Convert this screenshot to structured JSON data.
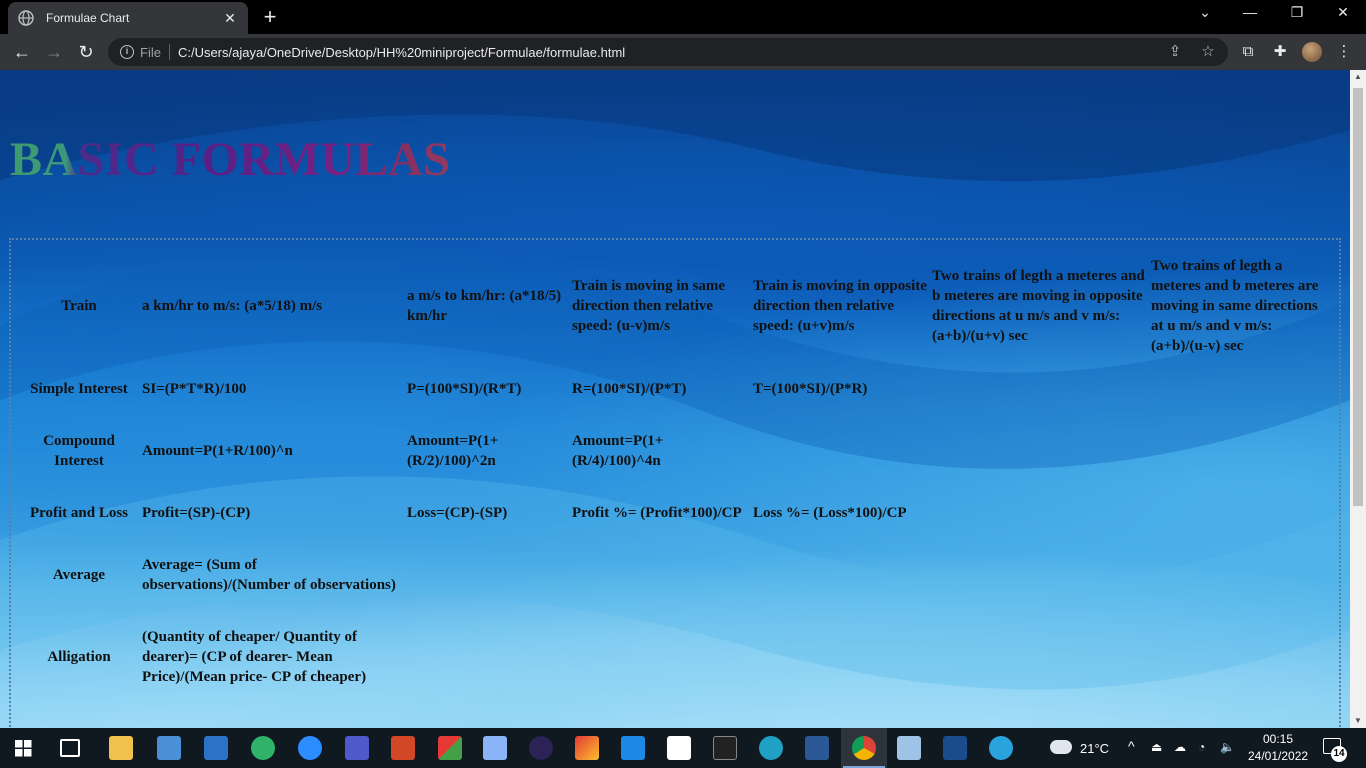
{
  "browser": {
    "tab_title": "Formulae Chart",
    "file_label": "File",
    "url": "C:/Users/ajaya/OneDrive/Desktop/HH%20miniproject/Formulae/formulae.html"
  },
  "page": {
    "title": "BASIC FORMULAS",
    "rows": [
      {
        "head": "Train",
        "cells": [
          "a km/hr to m/s: (a*5/18) m/s",
          "a m/s to km/hr: (a*18/5) km/hr",
          "Train is moving in same direction then relative speed: (u-v)m/s",
          "Train is moving in opposite direction then relative speed: (u+v)m/s",
          "Two trains of legth a meteres and b meteres are moving in opposite directions at u m/s and v m/s: (a+b)/(u+v) sec",
          "Two trains of legth a meteres and b meteres are moving in same directions at u m/s and v m/s: (a+b)/(u-v) sec"
        ]
      },
      {
        "head": "Simple Interest",
        "cells": [
          "SI=(P*T*R)/100",
          "P=(100*SI)/(R*T)",
          "R=(100*SI)/(P*T)",
          "T=(100*SI)/(P*R)",
          "",
          ""
        ]
      },
      {
        "head": "Compound Interest",
        "cells": [
          "Amount=P(1+R/100)^n",
          "Amount=P(1+ (R/2)/100)^2n",
          "Amount=P(1+ (R/4)/100)^4n",
          "",
          "",
          ""
        ]
      },
      {
        "head": "Profit and Loss",
        "cells": [
          "Profit=(SP)-(CP)",
          "Loss=(CP)-(SP)",
          "Profit %= (Profit*100)/CP",
          "Loss %= (Loss*100)/CP",
          "",
          ""
        ]
      },
      {
        "head": "Average",
        "cells": [
          "Average= (Sum of observations)/(Number of observations)",
          "",
          "",
          "",
          "",
          ""
        ]
      },
      {
        "head": "Alligation",
        "cells": [
          "(Quantity of cheaper/ Quantity of dearer)= (CP of dearer- Mean Price)/(Mean price- CP of cheaper)",
          "",
          "",
          "",
          "",
          ""
        ]
      }
    ]
  },
  "taskbar": {
    "temperature": "21°C",
    "time": "00:15",
    "date": "24/01/2022",
    "notification_count": "14"
  }
}
